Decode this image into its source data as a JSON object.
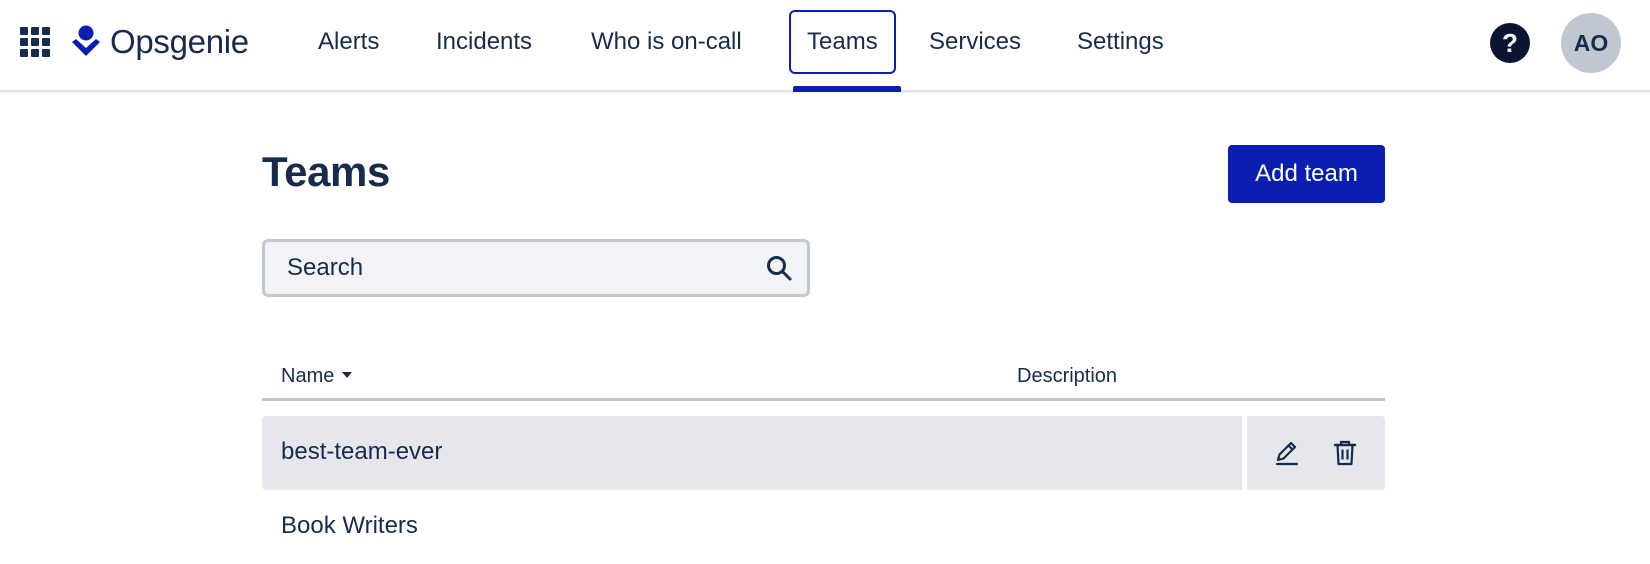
{
  "header": {
    "app_name": "Opsgenie",
    "nav": [
      {
        "label": "Alerts"
      },
      {
        "label": "Incidents"
      },
      {
        "label": "Who is on-call"
      },
      {
        "label": "Teams",
        "active": true
      },
      {
        "label": "Services"
      },
      {
        "label": "Settings"
      }
    ],
    "help_label": "?",
    "avatar_initials": "AO"
  },
  "main": {
    "title": "Teams",
    "add_button_label": "Add team",
    "search": {
      "placeholder": "Search",
      "value": ""
    },
    "table": {
      "columns": [
        {
          "label": "Name",
          "sorted": "descending"
        },
        {
          "label": "Description"
        }
      ],
      "rows": [
        {
          "name": "best-team-ever",
          "description": "",
          "hovered": true
        },
        {
          "name": "Book Writers",
          "description": ""
        }
      ]
    }
  },
  "colors": {
    "brand": "#0a1faf",
    "text": "#172b4d",
    "row_hover": "#e5e7ec"
  }
}
